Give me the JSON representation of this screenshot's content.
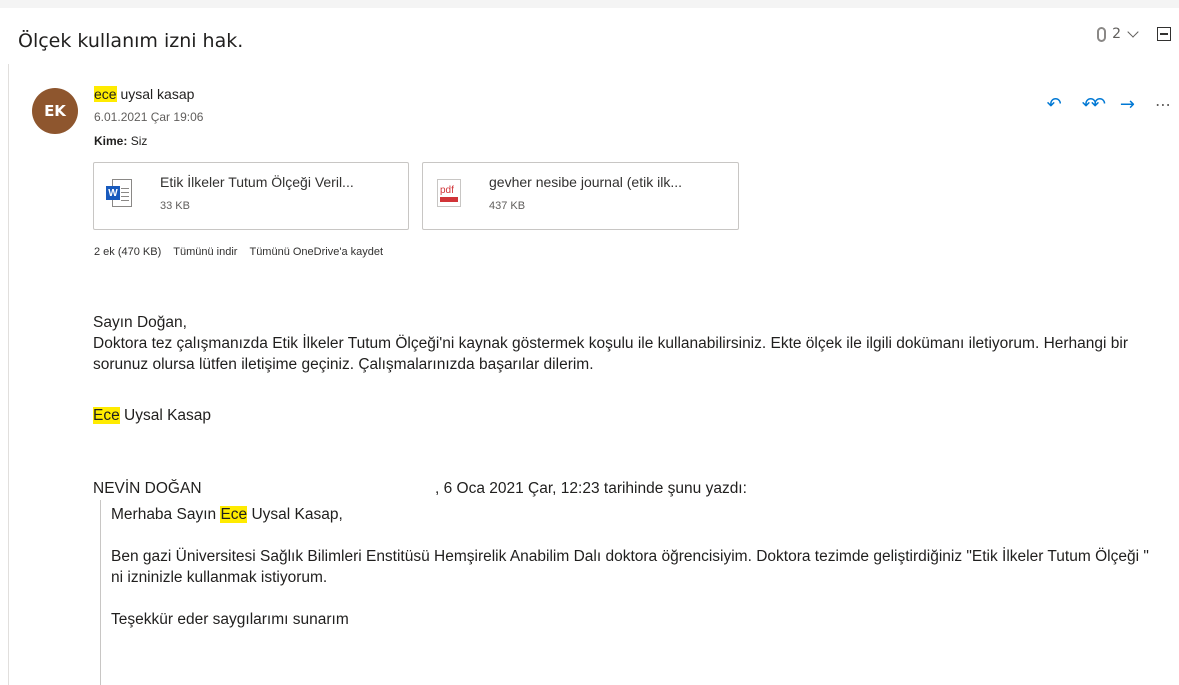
{
  "subject": "Ölçek kullanım izni hak.",
  "toolbar": {
    "attachment_count": "2"
  },
  "sender": {
    "initials": "EK",
    "avatar_color": "#8e562e",
    "name_highlight": "ece",
    "name_rest": " uysal kasap",
    "date": "6.01.2021 Çar 19:06",
    "to_label": "Kime:",
    "to_value": "Siz"
  },
  "attachments": [
    {
      "name": "Etik İlkeler Tutum Ölçeği Veril...",
      "size": "33 KB",
      "icon": "word-file-icon",
      "badge": "W"
    },
    {
      "name": "gevher nesibe journal (etik ilk...",
      "size": "437 KB",
      "icon": "pdf-file-icon",
      "badge": "pdf"
    }
  ],
  "attachment_summary": {
    "count": "2 ek (470 KB)",
    "download_all": "Tümünü indir",
    "save_onedrive": "Tümünü OneDrive'a kaydet"
  },
  "body": {
    "greeting": "Sayın Doğan,",
    "paragraph": "Doktora tez çalışmanızda Etik İlkeler Tutum Ölçeği'ni kaynak göstermek koşulu ile kullanabilirsiniz. Ekte ölçek ile ilgili dokümanı iletiyorum. Herhangi bir sorunuz olursa lütfen iletişime geçiniz. Çalışmalarınızda başarılar dilerim.",
    "signature_highlight": "Ece",
    "signature_rest": " Uysal Kasap"
  },
  "quoted": {
    "from_name": "NEVİN DOĞAN",
    "header_rest": ", 6 Oca 2021 Çar, 12:23 tarihinde şunu yazdı:",
    "greeting_pre": "Merhaba Sayın ",
    "greeting_highlight": "Ece",
    "greeting_post": " Uysal Kasap,",
    "paragraph": "Ben gazi Üniversitesi Sağlık Bilimleri Enstitüsü Hemşirelik Anabilim Dalı doktora öğrencisiyim. Doktora tezimde geliştirdiğiniz \"Etik İlkeler Tutum Ölçeği \" ni  izninizle kullanmak istiyorum.",
    "closing": "Teşekkür eder saygılarımı sunarım"
  },
  "colors": {
    "accent": "#0078d4",
    "highlight": "#ffeb00",
    "word": "#185abd",
    "pdf": "#d13438"
  }
}
